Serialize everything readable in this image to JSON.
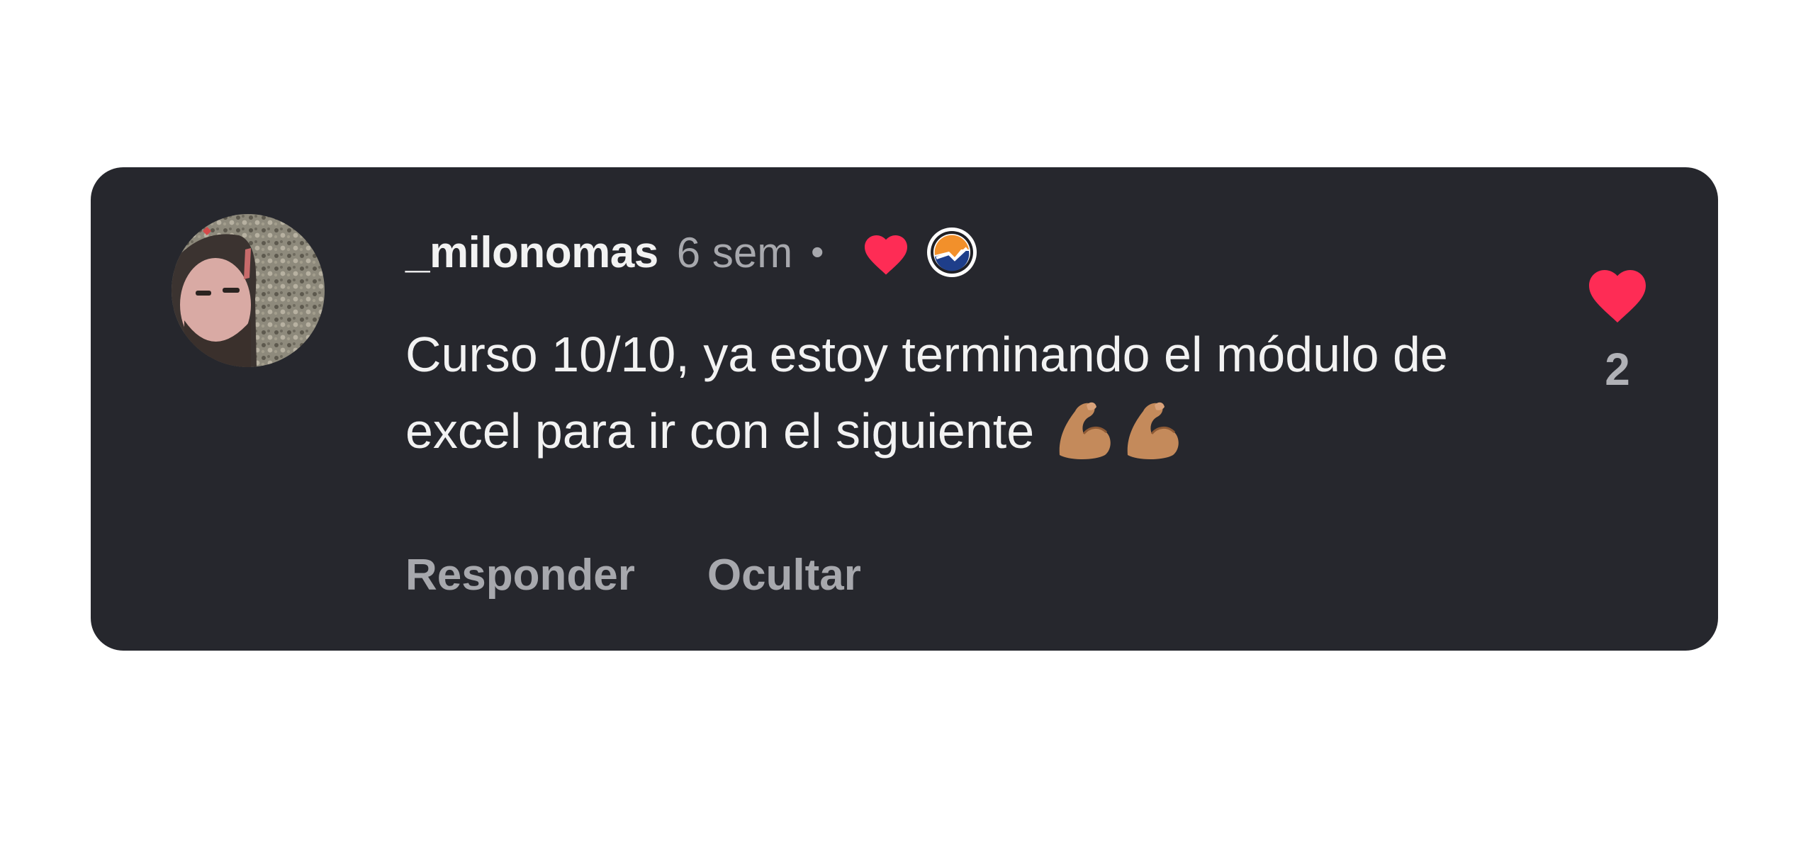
{
  "comment": {
    "username": "_milonomas",
    "timestamp": "6 sem",
    "separator": "•",
    "text": "Curso 10/10, ya estoy terminando el módulo de excel para ir con el siguiente",
    "emoji": "💪🏽💪🏽",
    "actions": {
      "reply_label": "Responder",
      "hide_label": "Ocultar"
    },
    "likes": {
      "count": "2",
      "liked": true
    },
    "creator_liked": true,
    "icons": {
      "avatar": "user-avatar",
      "creator_heart": "heart-icon",
      "creator_badge": "creator-avatar-icon",
      "like": "heart-icon",
      "emoji": "flexed-biceps-icon"
    }
  },
  "colors": {
    "card_background": "#26272d",
    "heart": "#fe2c55",
    "primary_text": "#f2f2f2",
    "secondary_text": "#a7a8ad"
  }
}
